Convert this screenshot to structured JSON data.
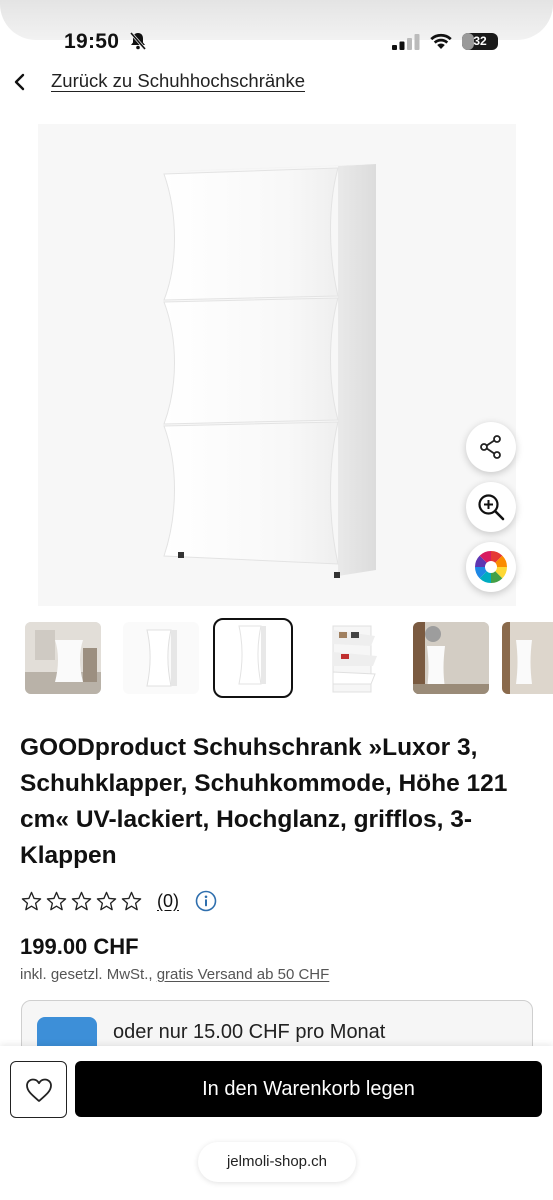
{
  "status_bar": {
    "time": "19:50",
    "battery": "32",
    "battery_level": 0.32
  },
  "nav": {
    "back_label": "Zurück zu Schuhhochschränke"
  },
  "product": {
    "title": "GOODproduct Schuhschrank »Luxor 3, Schuhklapper, Schuhkommode, Höhe 121 cm« UV-lackiert, Hochglanz, grifflos, 3-Klappen",
    "rating_stars": 0,
    "review_count": "(0)",
    "price": "199.00 CHF",
    "tax_note": "inkl. gesetzl. MwSt.,",
    "shipping_link": "gratis Versand ab 50 CHF"
  },
  "image_actions": [
    "share-icon",
    "zoom-in-icon",
    "color-wheel-icon"
  ],
  "thumbnails": [
    "room-scene",
    "side-view",
    "front-view",
    "open-flaps",
    "hallway-scene",
    "partial-room"
  ],
  "selected_thumbnail": 3,
  "installment": {
    "text": "oder nur 15.00 CHF pro Monat"
  },
  "actions": {
    "add_to_cart": "In den Warenkorb legen"
  },
  "browser": {
    "url": "jelmoli-shop.ch"
  },
  "colors": {
    "primary_button": "#000000",
    "installment_icon": "#3d8fd8"
  }
}
